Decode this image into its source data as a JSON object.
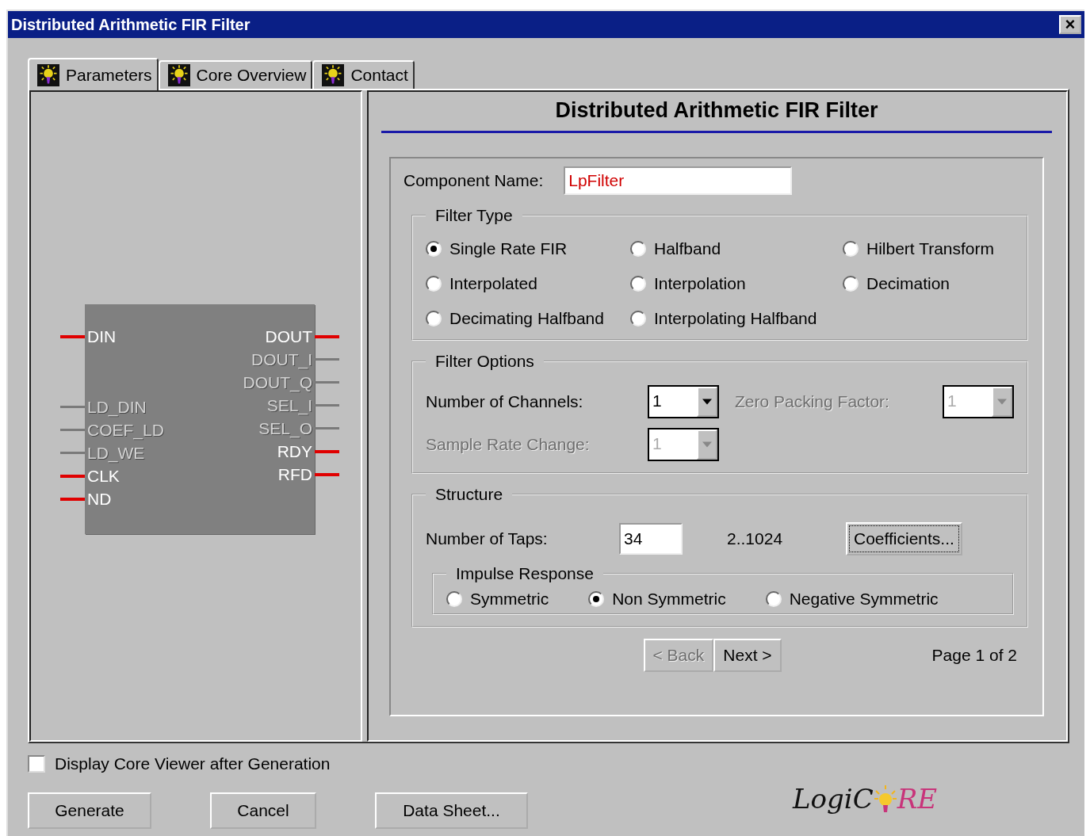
{
  "window": {
    "title": "Distributed Arithmetic FIR Filter",
    "close": "×"
  },
  "tabs": [
    {
      "label": "Parameters",
      "selected": true
    },
    {
      "label": "Core Overview",
      "selected": false
    },
    {
      "label": "Contact",
      "selected": false
    }
  ],
  "symbol": {
    "left_groups": [
      [
        {
          "name": "DIN",
          "active": true,
          "disabled": false
        }
      ],
      [
        {
          "name": "LD_DIN",
          "active": false,
          "disabled": true
        },
        {
          "name": "COEF_LD",
          "active": false,
          "disabled": true
        },
        {
          "name": "LD_WE",
          "active": false,
          "disabled": true
        },
        {
          "name": "CLK",
          "active": true,
          "disabled": false
        },
        {
          "name": "ND",
          "active": true,
          "disabled": false
        }
      ]
    ],
    "right_pins": [
      {
        "name": "DOUT",
        "active": true,
        "disabled": false
      },
      {
        "name": "DOUT_I",
        "active": false,
        "disabled": true
      },
      {
        "name": "DOUT_Q",
        "active": false,
        "disabled": true
      },
      {
        "name": "SEL_I",
        "active": false,
        "disabled": true
      },
      {
        "name": "SEL_O",
        "active": false,
        "disabled": true
      },
      {
        "name": "RDY",
        "active": true,
        "disabled": false
      },
      {
        "name": "RFD",
        "active": true,
        "disabled": false
      }
    ]
  },
  "heading": "Distributed Arithmetic FIR Filter",
  "component_name": {
    "label": "Component Name:",
    "value": "LpFilter"
  },
  "filter_type": {
    "legend": "Filter Type",
    "options": [
      {
        "label": "Single Rate FIR",
        "selected": true
      },
      {
        "label": "Halfband",
        "selected": false
      },
      {
        "label": "Hilbert Transform",
        "selected": false
      },
      {
        "label": "Interpolated",
        "selected": false
      },
      {
        "label": "Interpolation",
        "selected": false
      },
      {
        "label": "Decimation",
        "selected": false
      },
      {
        "label": "Decimating Halfband",
        "selected": false
      },
      {
        "label": "Interpolating Halfband",
        "selected": false
      }
    ]
  },
  "filter_options": {
    "legend": "Filter Options",
    "fields": [
      {
        "label": "Number of Channels:",
        "value": "1",
        "disabled": false
      },
      {
        "label": "Zero Packing Factor:",
        "value": "1",
        "disabled": true
      },
      {
        "label": "Sample Rate Change:",
        "value": "1",
        "disabled": true
      }
    ]
  },
  "structure": {
    "legend": "Structure",
    "taps_label": "Number of Taps:",
    "taps_value": "34",
    "taps_range": "2..1024",
    "coefficients_button": "Coefficients...",
    "impulse": {
      "legend": "Impulse Response",
      "options": [
        {
          "label": "Symmetric",
          "selected": false
        },
        {
          "label": "Non Symmetric",
          "selected": true
        },
        {
          "label": "Negative Symmetric",
          "selected": false
        }
      ]
    }
  },
  "nav": {
    "back": {
      "label": "< Back",
      "disabled": true
    },
    "next": {
      "label": "Next >",
      "disabled": false
    },
    "page": "Page 1 of 2"
  },
  "viewer_checkbox": {
    "label": "Display Core Viewer after Generation",
    "checked": false
  },
  "buttons": [
    "Generate",
    "Cancel",
    "Data Sheet..."
  ],
  "logo": {
    "left": "LogiC",
    "right": "RE"
  }
}
